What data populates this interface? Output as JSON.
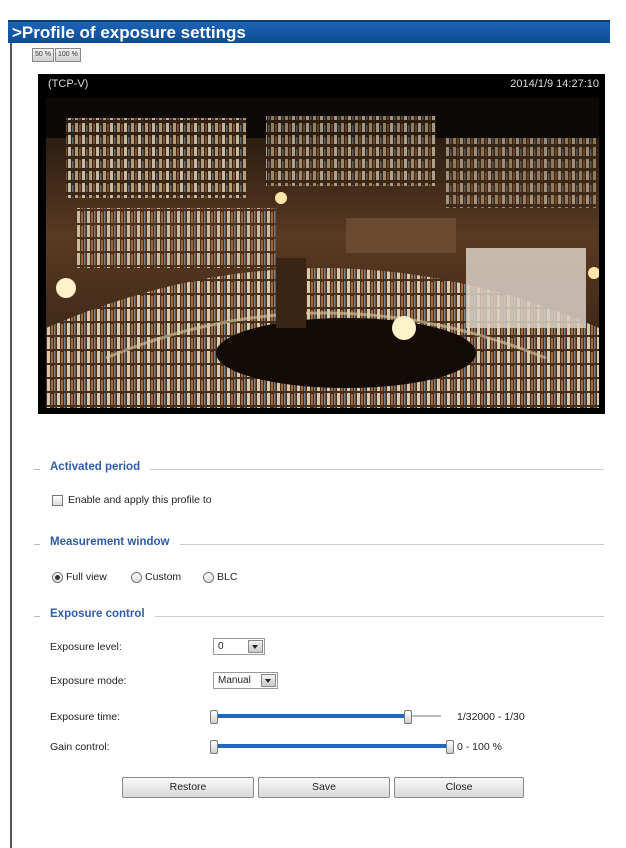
{
  "header": {
    "title": ">Profile of exposure settings"
  },
  "zoom": {
    "buttons": [
      "50 %",
      "100 %"
    ]
  },
  "video": {
    "stream_mode": "(TCP-V)",
    "timestamp": "2014/1/9 14:27:10"
  },
  "activated_period": {
    "heading": "Activated period",
    "checkbox_label": "Enable and apply this profile to",
    "checked": false
  },
  "measurement_window": {
    "heading": "Measurement window",
    "options": [
      "Full view",
      "Custom",
      "BLC"
    ],
    "selected": "Full view"
  },
  "exposure_control": {
    "heading": "Exposure control",
    "exposure_level": {
      "label": "Exposure level:",
      "value": "0"
    },
    "exposure_mode": {
      "label": "Exposure mode:",
      "value": "Manual"
    },
    "exposure_time": {
      "label": "Exposure time:",
      "range_text": "1/32000 - 1/30",
      "min_fraction": 0.0,
      "max_fraction": 0.85
    },
    "gain_control": {
      "label": "Gain control:",
      "range_text": "0 - 100 %",
      "min_fraction": 0.0,
      "max_fraction": 1.0
    }
  },
  "buttons": {
    "restore": "Restore",
    "save": "Save",
    "close": "Close"
  },
  "colors": {
    "accent": "#1f67b9",
    "heading": "#2e5da8",
    "title_bar": "#1d63b3"
  }
}
